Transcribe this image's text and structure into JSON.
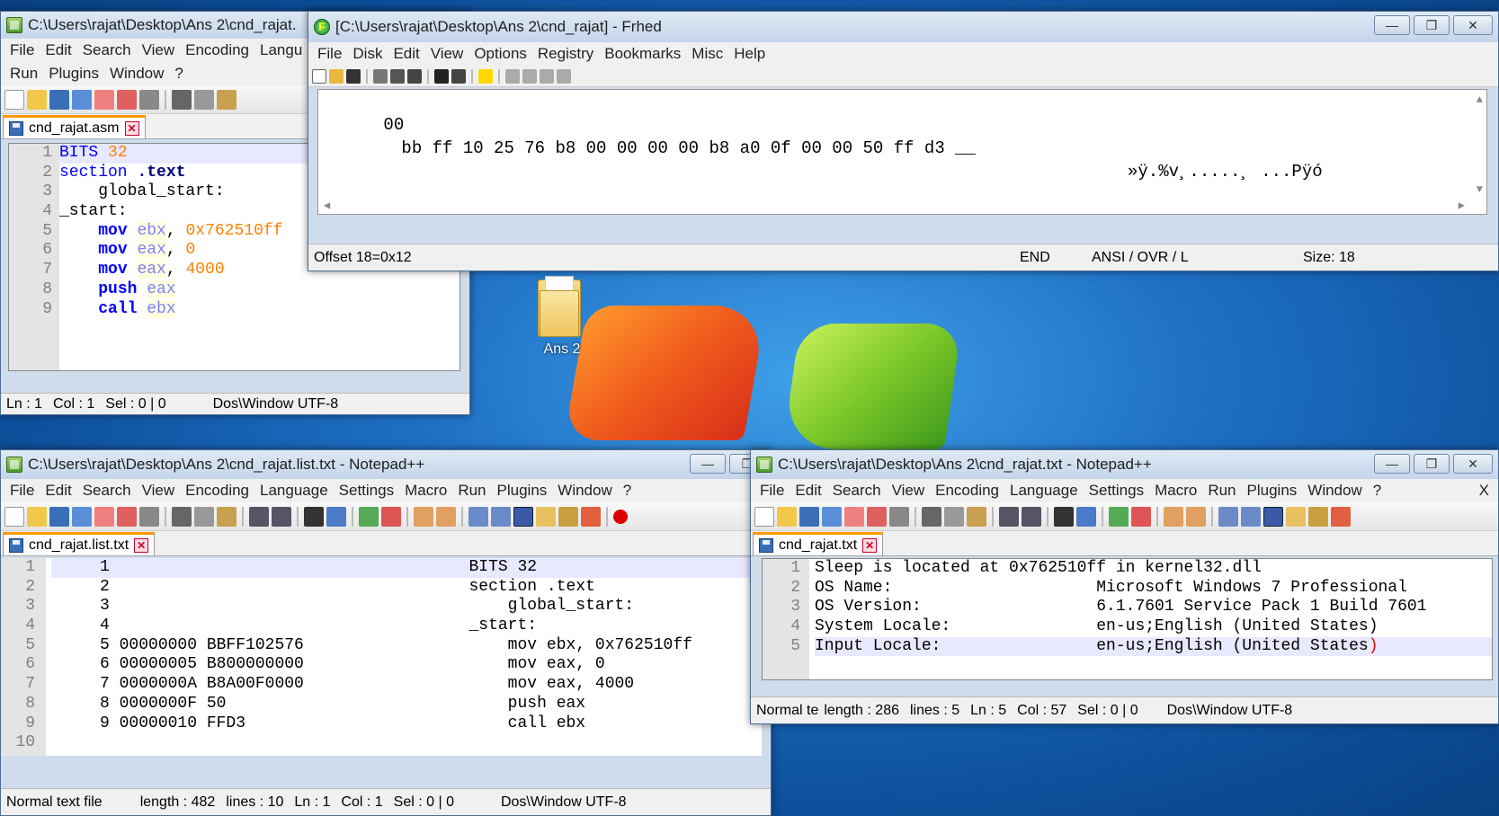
{
  "desktop": {
    "folder_label": "Ans 2"
  },
  "win_asm": {
    "title": "C:\\Users\\rajat\\Desktop\\Ans 2\\cnd_rajat.",
    "menu_row1": [
      "File",
      "Edit",
      "Search",
      "View",
      "Encoding",
      "Langu"
    ],
    "menu_row2": [
      "Run",
      "Plugins",
      "Window",
      "?"
    ],
    "tab": "cnd_rajat.asm",
    "line_numbers": [
      "1",
      "2",
      "3",
      "4",
      "5",
      "6",
      "7",
      "8",
      "9"
    ],
    "code": {
      "l1_kw": "BITS",
      "l1_num": "32",
      "l2_kw": "section",
      "l2_rest": ".text",
      "l3": "    global_start:",
      "l4": "_start:",
      "l5_op": "mov",
      "l5_reg": "ebx",
      "l5_num": "0x762510ff",
      "l6_op": "mov",
      "l6_reg": "eax",
      "l6_num": "0",
      "l7_op": "mov",
      "l7_reg": "eax",
      "l7_num": "4000",
      "l8_op": "push",
      "l8_reg": "eax",
      "l9_op": "call",
      "l9_reg": "ebx"
    },
    "status": {
      "ln": "Ln : 1",
      "col": "Col : 1",
      "sel": "Sel : 0 | 0",
      "eol": "Dos\\Window UTF-8"
    }
  },
  "win_frhed": {
    "title": "[C:\\Users\\rajat\\Desktop\\Ans 2\\cnd_rajat] - Frhed",
    "menu": [
      "File",
      "Disk",
      "Edit",
      "View",
      "Options",
      "Registry",
      "Bookmarks",
      "Misc",
      "Help"
    ],
    "hex_offset": "00",
    "hex_bytes": "bb ff 10 25 76 b8 00 00 00 00 b8 a0 0f 00 00 50 ff d3 __",
    "ascii": "»ÿ.%v¸.....¸ ...Pÿó",
    "status": {
      "offset": "Offset 18=0x12",
      "mode": "END",
      "charset": "ANSI / OVR / L",
      "size": "Size: 18"
    }
  },
  "win_list": {
    "title": "C:\\Users\\rajat\\Desktop\\Ans 2\\cnd_rajat.list.txt - Notepad++",
    "menu": [
      "File",
      "Edit",
      "Search",
      "View",
      "Encoding",
      "Language",
      "Settings",
      "Macro",
      "Run",
      "Plugins",
      "Window",
      "?"
    ],
    "tab": "cnd_rajat.list.txt",
    "lines": [
      {
        "n": "1",
        "text": "     1                                     BITS 32"
      },
      {
        "n": "2",
        "text": "     2                                     section .text"
      },
      {
        "n": "3",
        "text": "     3                                         global_start:"
      },
      {
        "n": "4",
        "text": "     4                                     _start:"
      },
      {
        "n": "5",
        "text": "     5 00000000 BBFF102576                     mov ebx, 0x762510ff"
      },
      {
        "n": "6",
        "text": "     6 00000005 B800000000                     mov eax, 0"
      },
      {
        "n": "7",
        "text": "     7 0000000A B8A00F0000                     mov eax, 4000"
      },
      {
        "n": "8",
        "text": "     8 0000000F 50                             push eax"
      },
      {
        "n": "9",
        "text": "     9 00000010 FFD3                           call ebx"
      },
      {
        "n": "10",
        "text": ""
      }
    ],
    "status": {
      "type": "Normal text file",
      "length": "length : 482",
      "lines": "lines : 10",
      "ln": "Ln : 1",
      "col": "Col : 1",
      "sel": "Sel : 0 | 0",
      "eol": "Dos\\Window UTF-8"
    }
  },
  "win_txt": {
    "title": "C:\\Users\\rajat\\Desktop\\Ans 2\\cnd_rajat.txt - Notepad++",
    "menu": [
      "File",
      "Edit",
      "Search",
      "View",
      "Encoding",
      "Language",
      "Settings",
      "Macro",
      "Run",
      "Plugins",
      "Window",
      "?"
    ],
    "menu_close": "X",
    "tab": "cnd_rajat.txt",
    "lines": [
      {
        "n": "1",
        "text": "Sleep is located at 0x762510ff in kernel32.dll"
      },
      {
        "n": "2",
        "text": "OS Name:                     Microsoft Windows 7 Professional"
      },
      {
        "n": "3",
        "text": "OS Version:                  6.1.7601 Service Pack 1 Build 7601"
      },
      {
        "n": "4",
        "text": "System Locale:               en-us;English (United States)"
      },
      {
        "n": "5",
        "text_a": "Input Locale:                en-us;English ",
        "text_b": "(United States",
        "text_c": ")"
      }
    ],
    "status": {
      "type": "Normal te",
      "length": "length : 286",
      "lines": "lines : 5",
      "ln": "Ln : 5",
      "col": "Col : 57",
      "sel": "Sel : 0 | 0",
      "eol": "Dos\\Window UTF-8"
    }
  },
  "window_buttons": {
    "minimize": "—",
    "maximize": "❐",
    "close": "✕"
  }
}
